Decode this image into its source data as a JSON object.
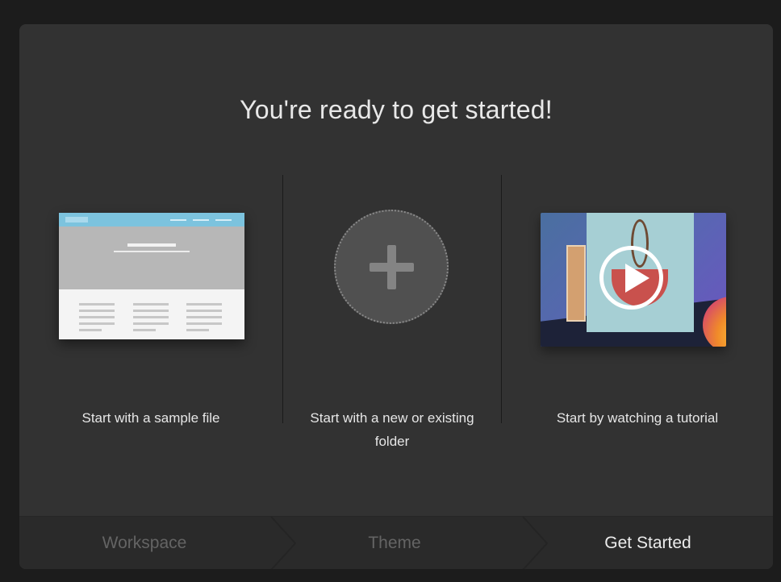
{
  "dialog": {
    "title": "You're ready to get started!"
  },
  "options": [
    {
      "label": "Start with a sample file"
    },
    {
      "label": "Start with a new or existing folder"
    },
    {
      "label": "Start by watching a tutorial"
    }
  ],
  "footer": {
    "steps": [
      {
        "label": "Workspace",
        "state": "inactive"
      },
      {
        "label": "Theme",
        "state": "inactive"
      },
      {
        "label": "Get Started",
        "state": "active"
      }
    ]
  },
  "colors": {
    "background": "#1c1c1c",
    "dialog": "#323232",
    "footer": "#2a2a2a",
    "active_step": "#ececec",
    "inactive_step": "#646464"
  },
  "icons": {
    "option_1": "sample-file-thumbnail",
    "option_2": "plus-icon",
    "option_3": "play-icon"
  }
}
